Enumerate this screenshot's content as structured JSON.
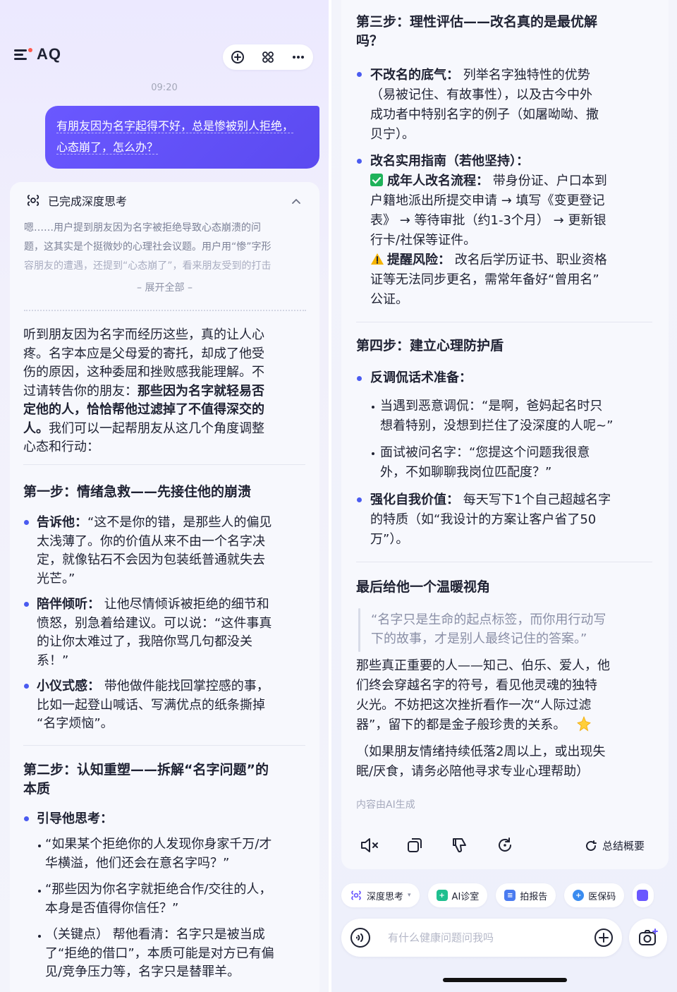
{
  "app": {
    "name": "AQ",
    "time": "09:20"
  },
  "user_message": {
    "line1": "有朋友因为名字起得不好，总是惨被别人拒绝，",
    "line2": "心态崩了，怎么办？"
  },
  "thinking": {
    "title": "已完成深度思考",
    "lines": [
      "嗯……用户提到朋友因为名字被拒绝导致心态崩溃的问",
      "题，这其实是个挺微妙的心理社会议题。用户用“惨”字形",
      "容朋友的遭遇，还提到“心态崩了”，看来朋友受到的打击"
    ],
    "expand_label": "– 展开全部 –"
  },
  "intro": {
    "l1": "听到朋友因为名字而经历这些，真的让人心",
    "l2": "疼。名字本应是父母爱的寄托，却成了他受",
    "l3": "伤的原因，这种委屈和挫败感我能理解。不",
    "l4a": "过请转告你的朋友：",
    "l4b": "那些因为名字就轻易否",
    "l5": "定他的人，恰恰帮他过滤掉了不值得深交的",
    "l6a": "人。",
    "l6b": "我们可以一起帮朋友从这几个角度调整",
    "l7": "心态和行动："
  },
  "step1": {
    "title": "第一步：情绪急救——先接住他的崩溃",
    "b1": {
      "head": "告诉他：",
      "l1": "“这不是你的错，是那些人的偏见",
      "l2": "太浅薄了。你的价值从来不由一个名字决",
      "l3": "定，就像钻石不会因为包装纸普通就失去",
      "l4": "光芒。”"
    },
    "b2": {
      "head": "陪伴倾听：",
      "l1": " 让他尽情倾诉被拒绝的细节和",
      "l2": "愤怒，别急着给建议。可以说：“这件事真",
      "l3": "的让你太难过了，我陪你骂几句都没关",
      "l4": "系！”"
    },
    "b3": {
      "head": "小仪式感：",
      "l1": " 带他做件能找回掌控感的事，",
      "l2": "比如一起登山喊话、写满优点的纸条撕掉",
      "l3": "“名字烦恼”。"
    }
  },
  "step2": {
    "title1": "第二步：认知重塑——拆解“名字问题”的",
    "title2": "本质",
    "b1": "引导他思考：",
    "s1": {
      "l1": "“如果某个拒绝你的人发现你身家千万/才",
      "l2": "华横溢，他们还会在意名字吗？”"
    },
    "s2": {
      "l1": "“那些因为你名字就拒绝合作/交往的人，",
      "l2": "本身是否值得你信任？”"
    },
    "s3": {
      "l1": "（关键点） 帮他看清：名字只是被当成",
      "l2": "了“拒绝的借口”，本质可能是对方已有偏",
      "l3": "见/竞争压力等，名字只是替罪羊。"
    }
  },
  "step3": {
    "title1": "第三步：理性评估——改名真的是最优解",
    "title2": "吗？",
    "b1": {
      "head": "不改名的底气：",
      "l1": " 列举名字独特性的优势",
      "l2": "（易被记住、有故事性），以及古今中外",
      "l3": "成功者中特别名字的例子（如屠呦呦、撒",
      "l4": "贝宁）。"
    },
    "b2": {
      "head": "改名实用指南（若他坚持）：",
      "c_head": "成年人改名流程：",
      "c1": " 带身份证、户口本到",
      "c2": "户籍地派出所提交申请 → 填写《变更登记",
      "c3": "表》 → 等待审批（约1-3个月） → 更新银",
      "c4": "行卡/社保等证件。",
      "w_head": "提醒风险：",
      "w1": " 改名后学历证书、职业资格",
      "w2": "证等无法同步更名，需常年备好“曾用名”",
      "w3": "公证。"
    }
  },
  "step4": {
    "title": "第四步：建立心理防护盾",
    "b1": "反调侃话术准备：",
    "s1": {
      "l1": "当遇到恶意调侃：“是啊，爸妈起名时只",
      "l2": "想着特别，没想到拦住了没深度的人呢~”"
    },
    "s2": {
      "l1": "面试被问名字：“您提这个问题我很意",
      "l2": "外，不如聊聊我岗位匹配度？”"
    },
    "b2": {
      "head": "强化自我价值：",
      "l1": " 每天写下1个自己超越名字",
      "l2": "的特质（如“我设计的方案让客户省了50",
      "l3": "万”）。"
    }
  },
  "final": {
    "title": "最后给他一个温暖视角",
    "quote1": "“名字只是生命的起点标签，而你用行动写",
    "quote2": "下的故事，才是别人最终记住的答案。”",
    "p1": "那些真正重要的人——知己、伯乐、爱人，他",
    "p2": "们终会穿越名字的符号，看见他灵魂的独特",
    "p3": "火光。不妨把这次挫折看作一次“人际过滤",
    "p4": "器”，留下的都是金子般珍贵的关系。",
    "n1": "（如果朋友情绪持续低落2周以上，或出现失",
    "n2": "眠/厌食，请务必陪他寻求专业心理帮助）",
    "ai_note": "内容由AI生成"
  },
  "actions": {
    "summary": "总结概要"
  },
  "chips": [
    {
      "label": "深度思考",
      "color": "#6a58ff"
    },
    {
      "label": "AI诊室",
      "color": "#1fbf8f"
    },
    {
      "label": "拍报告",
      "color": "#4a7bf0"
    },
    {
      "label": "医保码",
      "color": "#3a8cf0"
    }
  ],
  "input": {
    "placeholder": "有什么健康问题问我吗"
  }
}
